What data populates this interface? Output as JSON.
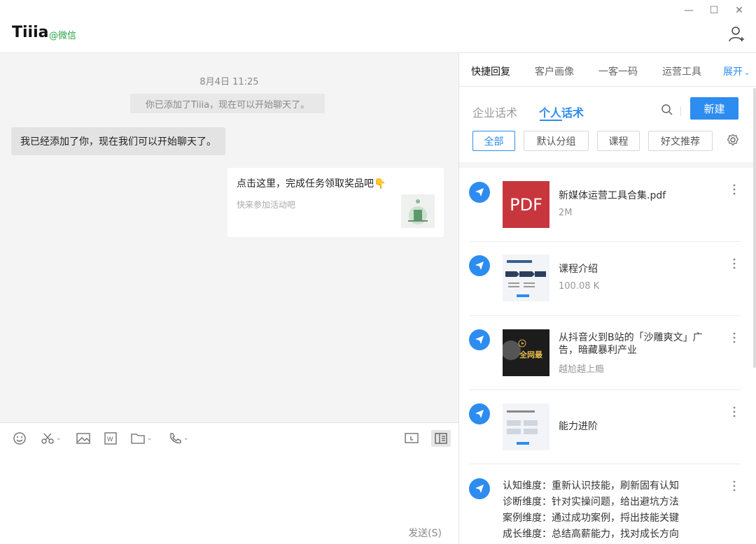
{
  "window": {
    "minimize": "—",
    "maximize": "☐",
    "close": "✕"
  },
  "header": {
    "title": "Tiiia",
    "subtitle": "@微信"
  },
  "chat": {
    "timestamp": "8月4日 11:25",
    "system_message": "你已添加了Tiiia，现在可以开始聊天了。",
    "message_left": "我已经添加了你，现在我们可以开始聊天了。",
    "card": {
      "title": "点击这里，完成任务领取奖品吧👇",
      "subtitle": "快来参加活动吧"
    }
  },
  "input": {
    "send_label": "发送(S)"
  },
  "panel": {
    "tabs": [
      "快捷回复",
      "客户画像",
      "一客一码",
      "运营工具"
    ],
    "expand_label": "展开",
    "subtabs": [
      "企业话术",
      "个人话术"
    ],
    "new_button": "新建",
    "chips": [
      "全部",
      "默认分组",
      "课程",
      "好文推荐"
    ],
    "items": [
      {
        "title": "新媒体运营工具合集.pdf",
        "subtitle": "2M",
        "thumb_text": "PDF"
      },
      {
        "title": "课程介绍",
        "subtitle": "100.08 K"
      },
      {
        "title": "从抖音火到B站的「沙雕爽文」广告，暗藏暴利产业",
        "subtitle": "越尬越上瘾",
        "thumb_text": "全网最"
      },
      {
        "title": "能力进阶",
        "subtitle": ""
      }
    ],
    "text_item": [
      "认知维度：重新认识技能，刷新固有认知",
      "诊断维度：针对实操问题，给出避坑方法",
      "案例维度：通过成功案例，捋出技能关键",
      "成长维度：总结高薪能力，找对成长方向"
    ]
  },
  "colors": {
    "accent": "#2d8cf0",
    "wechat_green": "#2ba245",
    "pdf_red": "#c8363d"
  }
}
